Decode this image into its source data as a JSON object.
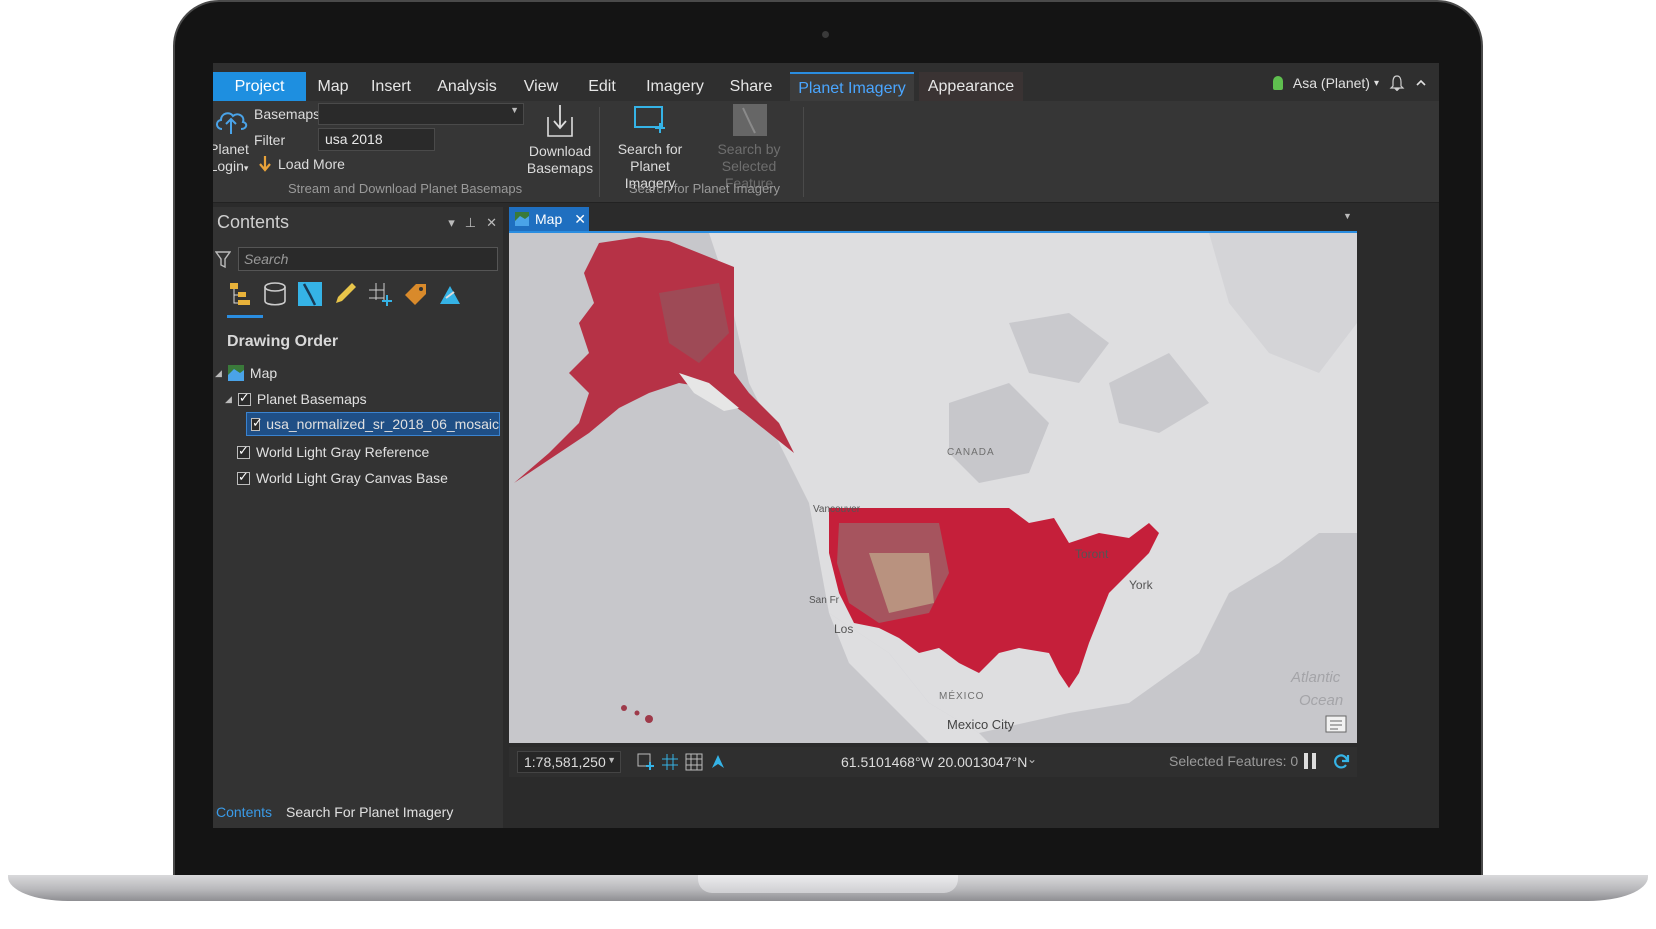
{
  "menu": {
    "tabs": [
      "Project",
      "Map",
      "Insert",
      "Analysis",
      "View",
      "Edit",
      "Imagery",
      "Share",
      "Planet Imagery",
      "Appearance"
    ],
    "active_tab": "Planet Imagery",
    "user": "Asa (Planet)",
    "user_caret": "▾",
    "bell_icon": "bell-icon",
    "collapse_icon": "chevron-up-icon"
  },
  "ribbon": {
    "planet_login": "Planet",
    "planet_login2": "Login",
    "login_caret": "▾",
    "basemaps_label": "Basemaps",
    "basemaps_value": "",
    "filter_label": "Filter",
    "filter_value": "usa 2018",
    "load_more": "Load More",
    "download_line1": "Download",
    "download_line2": "Basemaps",
    "group1_label": "Stream and Download Planet Basemaps",
    "search_line1": "Search for",
    "search_line2": "Planet Imagery",
    "searchsel_line1": "Search by",
    "searchsel_line2": "Selected Feature",
    "group2_label": "Search for Planet Imagery"
  },
  "contents": {
    "title": "Contents",
    "search_placeholder": "Search",
    "drawing_order": "Drawing Order",
    "layers": {
      "map": "Map",
      "planet_basemaps": "Planet Basemaps",
      "mosaic": "usa_normalized_sr_2018_06_mosaic",
      "reference": "World Light Gray Reference",
      "canvas": "World Light Gray Canvas Base"
    },
    "footer_tabs": [
      "Contents",
      "Search For Planet Imagery"
    ]
  },
  "mapview": {
    "tab_label": "Map",
    "scale": "1:78,581,250",
    "coordinates": "61.5101468°W 20.0013047°N",
    "selected_features": "Selected Features: 0",
    "labels": {
      "canada": "CANADA",
      "mexico": "MÉXICO",
      "mexico_city": "Mexico City",
      "atlantic": "Atlantic",
      "ocean": "Ocean",
      "vancouver": "Vancouver",
      "san_francisco": "San Fr",
      "los_angeles": "Los",
      "toronto": "Toront",
      "new_york": "York"
    }
  },
  "colors": {
    "accent": "#1e8fe0",
    "imagery_red": "#c51f3a",
    "map_gray": "#c8c8cc"
  }
}
